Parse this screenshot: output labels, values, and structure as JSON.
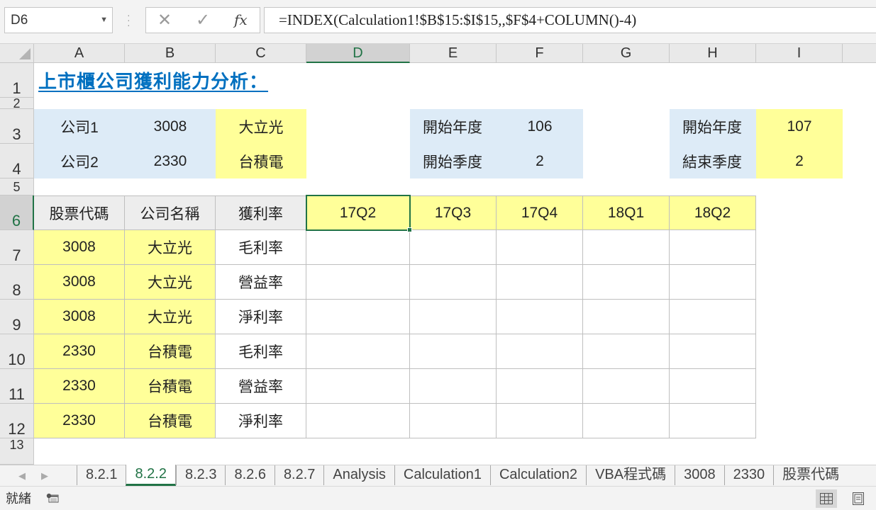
{
  "formula_bar": {
    "name_box": "D6",
    "cancel_glyph": "✕",
    "enter_glyph": "✓",
    "fx_glyph": "fx",
    "formula": "=INDEX(Calculation1!$B$15:$I$15,,$F$4+COLUMN()-4)"
  },
  "columns": [
    "A",
    "B",
    "C",
    "D",
    "E",
    "F",
    "G",
    "H",
    "I"
  ],
  "rows": [
    "1",
    "2",
    "3",
    "4",
    "5",
    "6",
    "7",
    "8",
    "9",
    "10",
    "11",
    "12",
    "13"
  ],
  "sheet": {
    "title": "上市櫃公司獲利能力分析：",
    "company1_label": "公司1",
    "company1_code": "3008",
    "company1_name": "大立光",
    "company2_label": "公司2",
    "company2_code": "2330",
    "company2_name": "台積電",
    "start_year_label": "開始年度",
    "start_year": "106",
    "start_quarter_label": "開始季度",
    "start_quarter": "2",
    "end_year_label": "開始年度",
    "end_year": "107",
    "end_quarter_label": "結束季度",
    "end_quarter": "2",
    "table_headers": [
      "股票代碼",
      "公司名稱",
      "獲利率"
    ],
    "quarters": [
      "17Q2",
      "17Q3",
      "17Q4",
      "18Q1",
      "18Q2"
    ],
    "table_rows": [
      {
        "code": "3008",
        "name": "大立光",
        "metric": "毛利率"
      },
      {
        "code": "3008",
        "name": "大立光",
        "metric": "營益率"
      },
      {
        "code": "3008",
        "name": "大立光",
        "metric": "淨利率"
      },
      {
        "code": "2330",
        "name": "台積電",
        "metric": "毛利率"
      },
      {
        "code": "2330",
        "name": "台積電",
        "metric": "營益率"
      },
      {
        "code": "2330",
        "name": "台積電",
        "metric": "淨利率"
      }
    ]
  },
  "tabs": [
    "8.2.1",
    "8.2.2",
    "8.2.3",
    "8.2.6",
    "8.2.7",
    "Analysis",
    "Calculation1",
    "Calculation2",
    "VBA程式碼",
    "3008",
    "2330",
    "股票代碼"
  ],
  "active_tab": "8.2.2",
  "status": {
    "ready": "就緒"
  },
  "colors": {
    "accent": "#217346",
    "blue_fill": "#ddebf7",
    "yellow_fill": "#ffff99",
    "title": "#0070c0"
  }
}
